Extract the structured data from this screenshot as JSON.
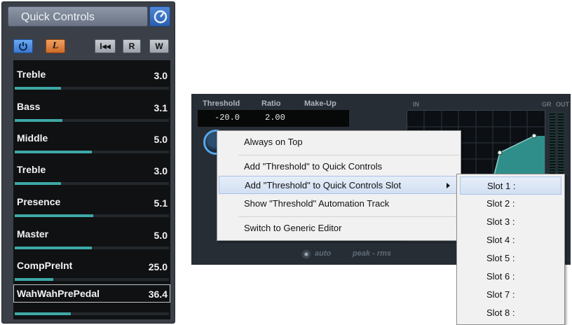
{
  "quick_controls": {
    "title": "Quick Controls",
    "settings_icon": "gear-icon",
    "buttons": {
      "power_icon": "power-icon",
      "learn_label": "L",
      "rewind_label": "I◂◂",
      "read_label": "R",
      "write_label": "W"
    },
    "slots": [
      {
        "name": "Treble",
        "value": "3.0",
        "level": 0.3
      },
      {
        "name": "Bass",
        "value": "3.1",
        "level": 0.31
      },
      {
        "name": "Middle",
        "value": "5.0",
        "level": 0.5
      },
      {
        "name": "Treble",
        "value": "3.0",
        "level": 0.3
      },
      {
        "name": "Presence",
        "value": "5.1",
        "level": 0.51
      },
      {
        "name": "Master",
        "value": "5.0",
        "level": 0.5
      },
      {
        "name": "CompPreInt",
        "value": "25.0",
        "level": 0.25
      },
      {
        "name": "WahWahPrePedal",
        "value": "36.4",
        "level": 0.364
      }
    ],
    "selected_slot": 7
  },
  "compressor": {
    "headers": {
      "threshold": "Threshold",
      "ratio": "Ratio",
      "makeup": "Make-Up"
    },
    "threshold_value": "-20.0",
    "ratio_value": "2.00",
    "meter_labels": {
      "in": "IN",
      "gr": "GR",
      "out": "OUT"
    },
    "auto_label": "auto",
    "detect_label": "peak - rms"
  },
  "context_menu": {
    "items": [
      {
        "label": "Always on Top"
      },
      {
        "label": "Add \"Threshold\" to Quick Controls"
      },
      {
        "label": "Add \"Threshold\" to Quick Controls Slot",
        "has_submenu": true,
        "highlighted": true
      },
      {
        "label": "Show \"Threshold\" Automation Track"
      },
      {
        "label": "Switch to Generic Editor"
      }
    ]
  },
  "slot_submenu": {
    "items": [
      "Slot 1 :",
      "Slot 2 :",
      "Slot 3 :",
      "Slot 4 :",
      "Slot 5 :",
      "Slot 6 :",
      "Slot 7 :",
      "Slot 8 :"
    ],
    "highlighted_index": 0
  },
  "colors": {
    "accent_blue": "#3a78d0",
    "learn_orange": "#d06a28",
    "slot_bar": "#3ea8a6",
    "menu_highlight": "#d2e0f3"
  }
}
